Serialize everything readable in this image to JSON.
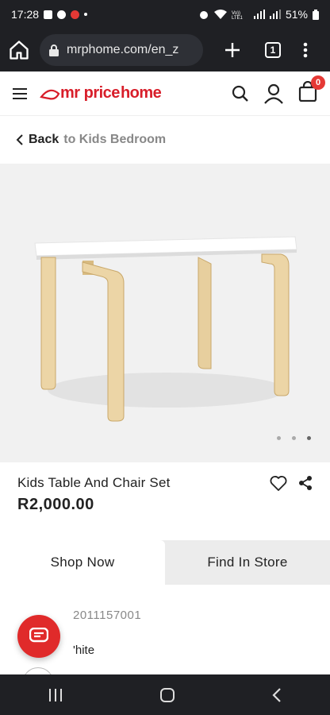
{
  "status_bar": {
    "time": "17:28",
    "battery": "51%"
  },
  "browser": {
    "url": "mrphome.com/en_z",
    "tab_count": "1"
  },
  "header": {
    "logo_mr": "mr price",
    "logo_home": "home",
    "cart_count": "0"
  },
  "breadcrumb": {
    "back_label": "Back",
    "to_label": "to Kids Bedroom"
  },
  "carousel": {
    "slide_count": 3,
    "active_slide": 3
  },
  "product": {
    "name": "Kids Table And Chair Set",
    "price": "R2,000.00",
    "sku": "2011157001",
    "color_partial": "'hite"
  },
  "tabs": [
    {
      "label": "Shop Now"
    },
    {
      "label": "Find In Store"
    }
  ],
  "colors": {
    "brand_red": "#d81e2a",
    "status_bg": "#1f2024"
  }
}
